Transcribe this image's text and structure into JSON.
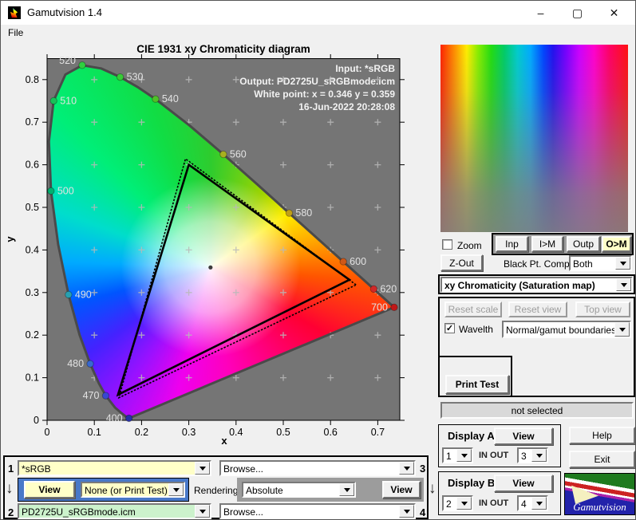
{
  "window": {
    "title": "Gamutvision 1.4",
    "menu_file": "File",
    "min": "–",
    "max": "▢",
    "close": "✕"
  },
  "icons": {
    "check": "✓",
    "arrow_down": "↓"
  },
  "chart_data": {
    "type": "scatter",
    "title": "CIE 1931 xy Chromaticity diagram",
    "xlabel": "x",
    "ylabel": "y",
    "xlim": [
      0,
      0.75
    ],
    "ylim": [
      0,
      0.85
    ],
    "x_ticks": [
      "0",
      "0.1",
      "0.2",
      "0.3",
      "0.4",
      "0.5",
      "0.6",
      "0.7"
    ],
    "y_ticks": [
      "0",
      "0.1",
      "0.2",
      "0.3",
      "0.4",
      "0.5",
      "0.6",
      "0.7",
      "0.8"
    ],
    "grid_x": [
      0.1,
      0.2,
      0.3,
      0.4,
      0.5,
      0.6,
      0.7
    ],
    "grid_y": [
      0.1,
      0.2,
      0.3,
      0.4,
      0.5,
      0.6,
      0.7,
      0.8
    ],
    "annotations": [
      "Input:  *sRGB",
      "Output: PD2725U_sRGBmode.icm",
      "White point:  x = 0.346  y = 0.359",
      "16-Jun-2022 20:28:08"
    ],
    "white_point": {
      "x": 0.346,
      "y": 0.359
    },
    "spectral_locus": [
      [
        0.1741,
        0.005
      ],
      [
        0.1726,
        0.0048
      ],
      [
        0.1689,
        0.0069
      ],
      [
        0.1566,
        0.0177
      ],
      [
        0.144,
        0.0297
      ],
      [
        0.1241,
        0.0578
      ],
      [
        0.1096,
        0.0868
      ],
      [
        0.0913,
        0.1327
      ],
      [
        0.0687,
        0.2007
      ],
      [
        0.0454,
        0.295
      ],
      [
        0.0235,
        0.4127
      ],
      [
        0.0082,
        0.5384
      ],
      [
        0.0039,
        0.6548
      ],
      [
        0.0139,
        0.7502
      ],
      [
        0.0389,
        0.812
      ],
      [
        0.0743,
        0.8338
      ],
      [
        0.1142,
        0.8262
      ],
      [
        0.1547,
        0.8059
      ],
      [
        0.1929,
        0.7816
      ],
      [
        0.2296,
        0.7543
      ],
      [
        0.3016,
        0.6923
      ],
      [
        0.3731,
        0.6245
      ],
      [
        0.4441,
        0.5547
      ],
      [
        0.5125,
        0.4866
      ],
      [
        0.5752,
        0.4242
      ],
      [
        0.627,
        0.3725
      ],
      [
        0.6658,
        0.334
      ],
      [
        0.6915,
        0.3083
      ],
      [
        0.7079,
        0.292
      ],
      [
        0.726,
        0.274
      ],
      [
        0.7347,
        0.2653
      ]
    ],
    "wavelength_markers": [
      {
        "nm": "400",
        "x": 0.1733,
        "y": 0.0048,
        "color": "#2830a8",
        "side": "left",
        "dy": 0
      },
      {
        "nm": "470",
        "x": 0.1241,
        "y": 0.0578,
        "color": "#3848d0",
        "side": "left",
        "dy": 0
      },
      {
        "nm": "480",
        "x": 0.0913,
        "y": 0.1327,
        "color": "#3868d0",
        "side": "left",
        "dy": 0
      },
      {
        "nm": "490",
        "x": 0.0454,
        "y": 0.295,
        "color": "#28a0b0",
        "side": "right",
        "dy": 0
      },
      {
        "nm": "500",
        "x": 0.0082,
        "y": 0.5384,
        "color": "#00b070",
        "side": "right",
        "dy": 0
      },
      {
        "nm": "510",
        "x": 0.0139,
        "y": 0.7502,
        "color": "#18c058",
        "side": "right",
        "dy": 0
      },
      {
        "nm": "520",
        "x": 0.0743,
        "y": 0.8338,
        "color": "#30d040",
        "side": "left",
        "dy": -6
      },
      {
        "nm": "530",
        "x": 0.1547,
        "y": 0.8059,
        "color": "#38cc38",
        "side": "right",
        "dy": 0
      },
      {
        "nm": "540",
        "x": 0.2296,
        "y": 0.7543,
        "color": "#50c028",
        "side": "right",
        "dy": 0
      },
      {
        "nm": "560",
        "x": 0.3731,
        "y": 0.6245,
        "color": "#a8b020",
        "side": "right",
        "dy": 0
      },
      {
        "nm": "580",
        "x": 0.5125,
        "y": 0.4866,
        "color": "#c0a018",
        "side": "right",
        "dy": 0
      },
      {
        "nm": "600",
        "x": 0.627,
        "y": 0.3725,
        "color": "#d05818",
        "side": "right",
        "dy": 0
      },
      {
        "nm": "620",
        "x": 0.6915,
        "y": 0.3083,
        "color": "#d02828",
        "side": "right",
        "dy": 0
      },
      {
        "nm": "700",
        "x": 0.7347,
        "y": 0.2653,
        "color": "#c01818",
        "side": "left",
        "dy": 0
      }
    ],
    "input_gamut": {
      "name": "*sRGB",
      "vertices": [
        [
          0.64,
          0.33
        ],
        [
          0.3,
          0.6
        ],
        [
          0.15,
          0.06
        ]
      ]
    },
    "output_gamut": {
      "name": "PD2725U_sRGBmode.icm",
      "vertices": [
        [
          0.654,
          0.318
        ],
        [
          0.293,
          0.614
        ],
        [
          0.152,
          0.053
        ]
      ]
    }
  },
  "right_panel": {
    "zoom_label": "Zoom",
    "buttons": {
      "inp": "Inp",
      "im": "I>M",
      "outp": "Outp",
      "om": "O>M"
    },
    "zout": "Z-Out",
    "black_pt_label": "Black Pt. Comp.",
    "black_pt_value": "Both",
    "view_mode": "xy Chromaticity (Saturation map)",
    "reset_scale": "Reset scale",
    "reset_view": "Reset view",
    "top_view": "Top view",
    "wavelth_label": "Wavelth",
    "wavelth_value": "Normal/gamut boundaries",
    "print_test": "Print Test",
    "status": "not selected",
    "display_a": {
      "title": "Display A",
      "view": "View",
      "in_value": "1",
      "inout": "IN  OUT",
      "out_value": "3"
    },
    "display_b": {
      "title": "Display B",
      "view": "View",
      "in_value": "2",
      "inout": "IN  OUT",
      "out_value": "4"
    },
    "help": "Help",
    "exit": "Exit",
    "logo_text": "Gamutvision"
  },
  "bottom_panel": {
    "row1": {
      "num": "1",
      "value": "*sRGB",
      "browse": "Browse...",
      "num_right": "3"
    },
    "mid": {
      "view_a": "View",
      "none_value": "None (or Print Test)",
      "rendering": "Rendering",
      "intent": "Absolute",
      "view_b": "View"
    },
    "row3": {
      "num": "2",
      "value": "PD2725U_sRGBmode.icm",
      "browse": "Browse...",
      "num_right": "4"
    },
    "colors": {
      "input_field": "#ffffc8",
      "output_field": "#ccf2cc",
      "left_panel": "#4878c8",
      "right_panel": "#9c9c9c"
    }
  }
}
